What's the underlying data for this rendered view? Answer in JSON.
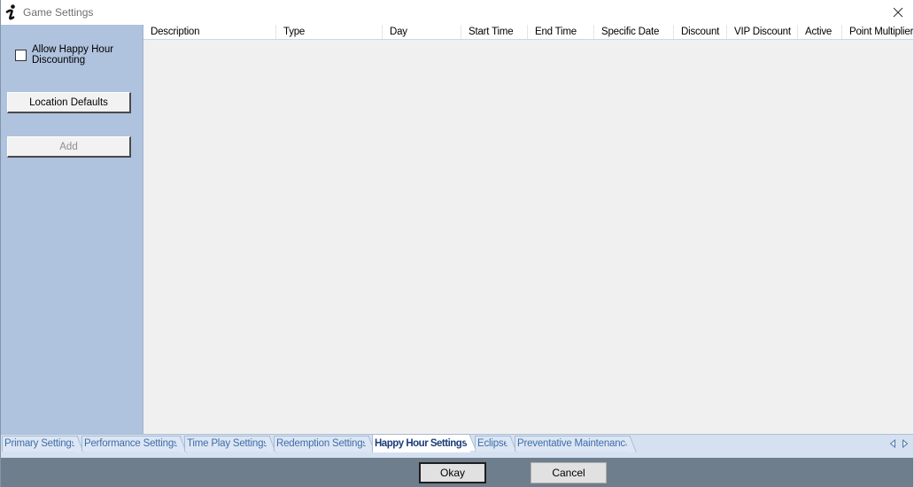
{
  "window": {
    "title": "Game Settings",
    "app_icon": "info-i-icon",
    "close_icon": "close-icon"
  },
  "left_panel": {
    "allow_happy_hour": {
      "label": "Allow Happy Hour Discounting",
      "checked": false
    },
    "location_defaults_button": {
      "label": "Location Defaults",
      "enabled": true
    },
    "add_button": {
      "label": "Add",
      "enabled": false
    }
  },
  "grid": {
    "columns": [
      "Description",
      "Type",
      "Day",
      "Start Time",
      "End Time",
      "Specific Date",
      "Discount",
      "VIP Discount",
      "Active",
      "Point Multiplier"
    ],
    "rows": []
  },
  "tabs": {
    "items": [
      {
        "label": "Primary Settings",
        "selected": false
      },
      {
        "label": "Performance Settings",
        "selected": false
      },
      {
        "label": "Time Play Settings",
        "selected": false
      },
      {
        "label": "Redemption Settings",
        "selected": false
      },
      {
        "label": "Happy Hour Settings",
        "selected": true
      },
      {
        "label": "Eclipse",
        "selected": false
      },
      {
        "label": "Preventative Maintenance",
        "selected": false
      }
    ],
    "scroll_left_icon": "chevron-left-icon",
    "scroll_right_icon": "chevron-right-icon"
  },
  "footer": {
    "okay_label": "Okay",
    "cancel_label": "Cancel"
  },
  "colors": {
    "panel": "#afc2de",
    "footer": "#6f7e8c",
    "grid_background": "#f0f0f0",
    "tab_text": "#3f6ea8",
    "tab_selected_text": "#1d3d78"
  }
}
